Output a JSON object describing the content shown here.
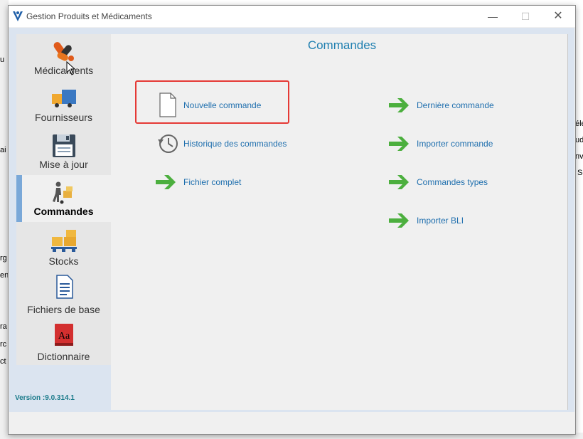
{
  "window": {
    "title": "Gestion Produits et Médicaments",
    "controls": {
      "minimize": "—",
      "maximize": "☐",
      "close": "✕"
    }
  },
  "sidebar": {
    "items": [
      {
        "label": "Médicaments",
        "icon": "pills-icon"
      },
      {
        "label": "Fournisseurs",
        "icon": "truck-icon"
      },
      {
        "label": "Mise à jour",
        "icon": "floppy-disk-icon"
      },
      {
        "label": "Commandes",
        "icon": "delivery-person-icon",
        "active": true
      },
      {
        "label": "Stocks",
        "icon": "boxes-on-pallet-icon"
      },
      {
        "label": "Fichiers de base",
        "icon": "document-icon"
      },
      {
        "label": "Dictionnaire",
        "icon": "dictionary-book-icon"
      }
    ],
    "version": "Version :9.0.314.1"
  },
  "panel": {
    "title": "Commandes",
    "left_actions": [
      {
        "label": "Nouvelle commande",
        "icon": "blank-document-icon",
        "highlighted": true
      },
      {
        "label": "Historique des commandes",
        "icon": "history-clock-icon"
      },
      {
        "label": "Fichier complet",
        "icon": "green-arrow-icon"
      }
    ],
    "right_actions": [
      {
        "label": "Dernière commande",
        "icon": "green-arrow-icon"
      },
      {
        "label": "Importer commande",
        "icon": "green-arrow-icon"
      },
      {
        "label": "Commandes types",
        "icon": "green-arrow-icon"
      },
      {
        "label": "Importer BLI",
        "icon": "green-arrow-icon"
      }
    ]
  },
  "background_fragments": {
    "left": [
      "u",
      "ai",
      "rg",
      "en",
      "ra",
      "rc",
      "ct"
    ],
    "right": [
      "élé",
      "ud",
      "nve",
      "Se"
    ]
  },
  "colors": {
    "accent": "#1f7fb0",
    "link": "#1f6fae",
    "arrow": "#4caf3e",
    "highlight_border": "#e53935",
    "active_bar": "#7aa8d8"
  }
}
